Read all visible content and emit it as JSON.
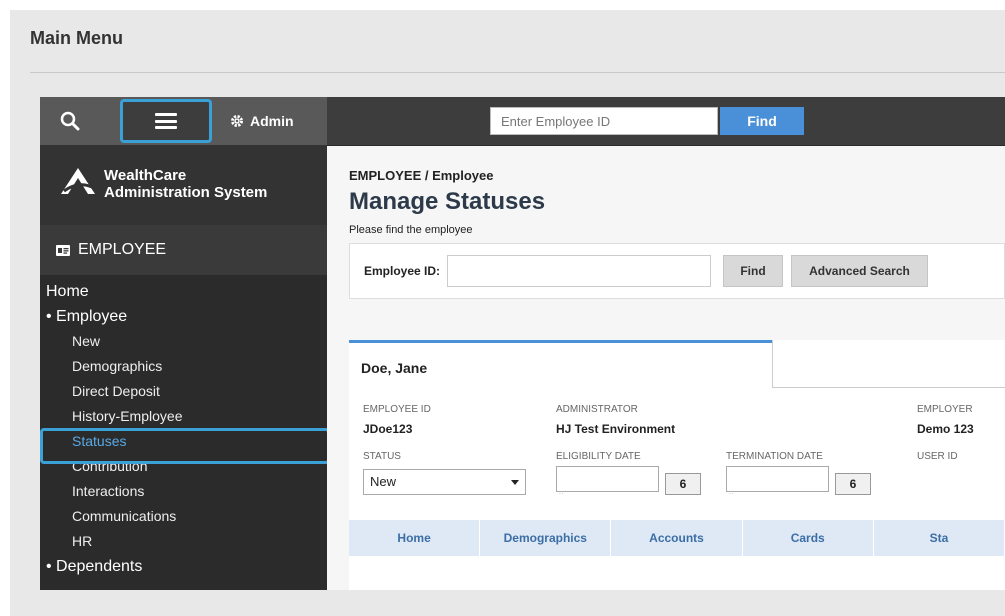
{
  "page": {
    "title": "Main Menu"
  },
  "topbar": {
    "admin_label": "Admin",
    "employee_id_placeholder": "Enter Employee ID",
    "find_label": "Find"
  },
  "sidebar": {
    "brand_line1": "WealthCare",
    "brand_line2": "Administration System",
    "section_label": "EMPLOYEE",
    "items": [
      {
        "label": "Home",
        "level": 0
      },
      {
        "label": "• Employee",
        "level": 0
      },
      {
        "label": "New",
        "level": 1
      },
      {
        "label": "Demographics",
        "level": 1
      },
      {
        "label": "Direct Deposit",
        "level": 1
      },
      {
        "label": "History-Employee",
        "level": 1
      },
      {
        "label": "Statuses",
        "level": 1,
        "active": true
      },
      {
        "label": "Contribution",
        "level": 1
      },
      {
        "label": "Interactions",
        "level": 1
      },
      {
        "label": "Communications",
        "level": 1
      },
      {
        "label": "HR",
        "level": 1
      },
      {
        "label": "• Dependents",
        "level": 0
      }
    ]
  },
  "content": {
    "breadcrumb": "EMPLOYEE / Employee",
    "title": "Manage Statuses",
    "subtitle": "Please find the employee",
    "search": {
      "label": "Employee ID:",
      "find_label": "Find",
      "advanced_label": "Advanced Search"
    },
    "employee": {
      "name": "Doe, Jane",
      "fields": {
        "employee_id_label": "EMPLOYEE ID",
        "employee_id_value": "JDoe123",
        "administrator_label": "ADMINISTRATOR",
        "administrator_value": "HJ Test Environment",
        "employer_label": "EMPLOYER",
        "employer_value": "Demo 123",
        "status_label": "STATUS",
        "status_value": "New",
        "eligibility_label": "ELIGIBILITY DATE",
        "termination_label": "TERMINATION DATE",
        "user_id_label": "USER ID",
        "calendar_label": "6"
      },
      "tabs": [
        "Home",
        "Demographics",
        "Accounts",
        "Cards",
        "Sta"
      ]
    }
  },
  "colors": {
    "accent": "#3aa0d6",
    "find_button": "#4a90d9",
    "sidebar_bg": "#2b2b2b",
    "active_link": "#59a9e6"
  }
}
